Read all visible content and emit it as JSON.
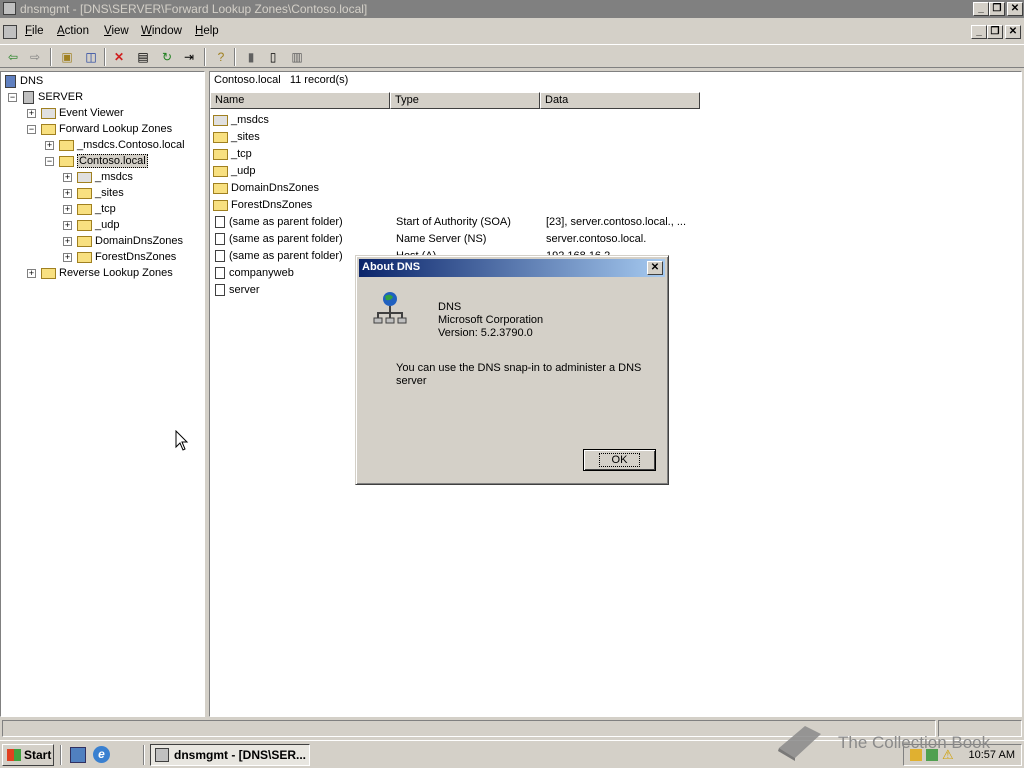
{
  "window": {
    "title": "dnsmgmt - [DNS\\SERVER\\Forward Lookup Zones\\Contoso.local]"
  },
  "menu": {
    "items": [
      {
        "first": "F",
        "rest": "ile"
      },
      {
        "first": "A",
        "rest": "ction"
      },
      {
        "first": "V",
        "rest": "iew"
      },
      {
        "first": "W",
        "rest": "indow"
      },
      {
        "first": "H",
        "rest": "elp"
      }
    ]
  },
  "tree": {
    "root": "DNS",
    "server": "SERVER",
    "event_viewer": "Event Viewer",
    "forward_zones": "Forward Lookup Zones",
    "msdcs_zone": "_msdcs.Contoso.local",
    "contoso": "Contoso.local",
    "children": [
      "_msdcs",
      "_sites",
      "_tcp",
      "_udp",
      "DomainDnsZones",
      "ForestDnsZones"
    ],
    "reverse_zones": "Reverse Lookup Zones"
  },
  "list": {
    "zone": "Contoso.local",
    "record_count": "11 record(s)",
    "columns": {
      "name": "Name",
      "type": "Type",
      "data": "Data"
    },
    "rows": [
      {
        "name": "_msdcs",
        "type": "",
        "data": ""
      },
      {
        "name": "_sites",
        "type": "",
        "data": ""
      },
      {
        "name": "_tcp",
        "type": "",
        "data": ""
      },
      {
        "name": "_udp",
        "type": "",
        "data": ""
      },
      {
        "name": "DomainDnsZones",
        "type": "",
        "data": ""
      },
      {
        "name": "ForestDnsZones",
        "type": "",
        "data": ""
      },
      {
        "name": "(same as parent folder)",
        "type": "Start of Authority (SOA)",
        "data": "[23], server.contoso.local., ..."
      },
      {
        "name": "(same as parent folder)",
        "type": "Name Server (NS)",
        "data": "server.contoso.local."
      },
      {
        "name": "(same as parent folder)",
        "type": "Host (A)",
        "data": "192.168.16.2"
      },
      {
        "name": "companyweb",
        "type": "",
        "data": ""
      },
      {
        "name": "server",
        "type": "",
        "data": ""
      }
    ]
  },
  "dialog": {
    "title": "About DNS",
    "product": "DNS",
    "company": "Microsoft Corporation",
    "version": "Version: 5.2.3790.0",
    "description_line1": "You can use the DNS snap-in to administer a DNS",
    "description_line2": "server",
    "ok": "OK"
  },
  "taskbar": {
    "start": "Start",
    "app": "dnsmgmt - [DNS\\SER...",
    "clock": "10:57 AM"
  },
  "watermark": "The Collection Book",
  "colors": {
    "dialog_title_start": "#0a246a",
    "dialog_title_end": "#a6caf0",
    "face": "#d4d0c8",
    "folder": "#f8e080"
  }
}
